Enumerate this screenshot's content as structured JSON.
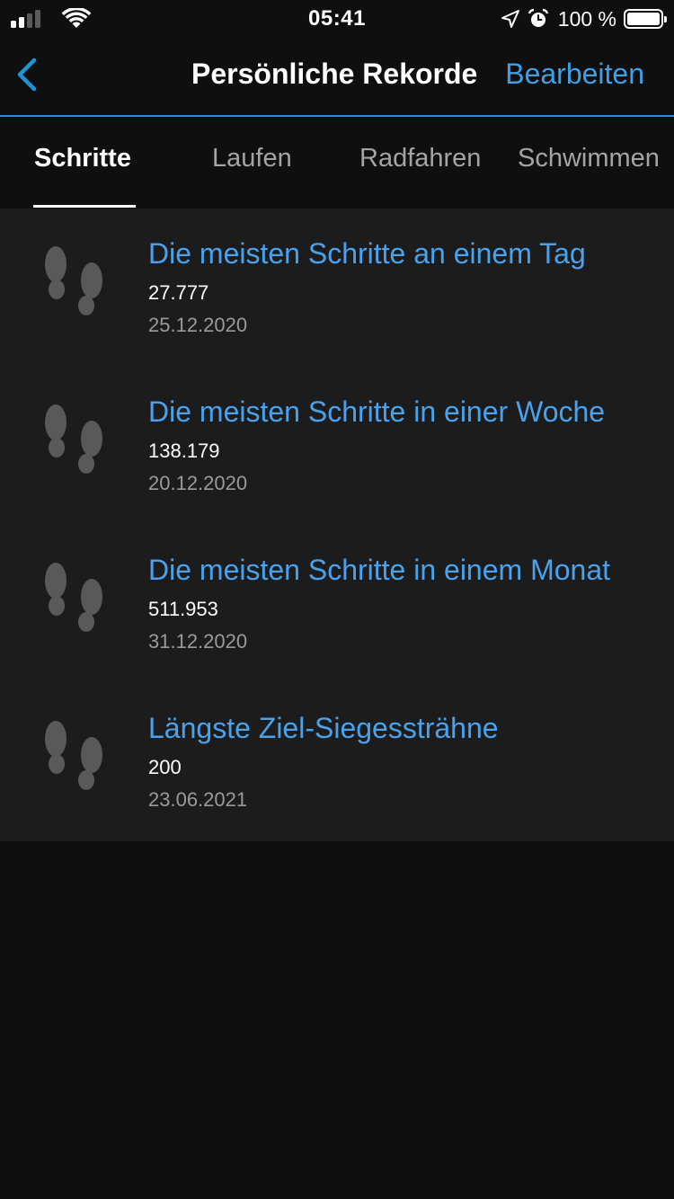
{
  "status_bar": {
    "time": "05:41",
    "battery_percent": "100 %",
    "signal_bars": 2,
    "signal_bars_total": 4
  },
  "nav": {
    "title": "Persönliche Rekorde",
    "edit_label": "Bearbeiten",
    "back_icon": "chevron-left-icon"
  },
  "tabs": [
    {
      "label": "Schritte",
      "active": true
    },
    {
      "label": "Laufen",
      "active": false
    },
    {
      "label": "Radfahren",
      "active": false
    },
    {
      "label": "Schwimmen",
      "active": false
    }
  ],
  "records": [
    {
      "title": "Die meisten Schritte an einem Tag",
      "value": "27.777",
      "date": "25.12.2020",
      "icon": "footsteps-icon"
    },
    {
      "title": "Die meisten Schritte in einer Woche",
      "value": "138.179",
      "date": "20.12.2020",
      "icon": "footsteps-icon"
    },
    {
      "title": "Die meisten Schritte in einem Monat",
      "value": "511.953",
      "date": "31.12.2020",
      "icon": "footsteps-icon"
    },
    {
      "title": "Längste Ziel-Siegessträhne",
      "value": "200",
      "date": "23.06.2021",
      "icon": "footsteps-icon"
    }
  ],
  "colors": {
    "accent": "#1f92d4",
    "link": "#4aa2ec",
    "background": "#0f0f0f",
    "list_background": "#1c1c1c",
    "icon": "#595959"
  }
}
